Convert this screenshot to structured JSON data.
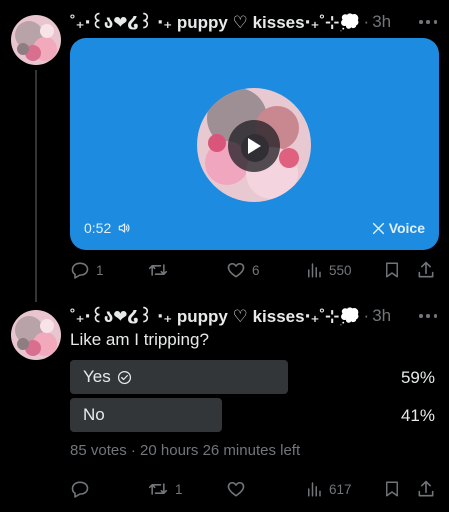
{
  "tweet1": {
    "author": "˚₊‧꒰ა❤︎໒꒱ ‧₊ puppy ♡ kisses‧₊˚⊹💭",
    "time": "3h",
    "voice": {
      "duration": "0:52",
      "label": "Voice"
    },
    "actions": {
      "replies": "1",
      "reposts": "",
      "likes": "6",
      "views": "550"
    }
  },
  "tweet2": {
    "author": "˚₊‧꒰ა❤︎໒꒱ ‧₊ puppy ♡ kisses‧₊˚⊹💭",
    "time": "3h",
    "text": "Like am I tripping?",
    "poll": {
      "options": [
        {
          "label": "Yes",
          "percent": "59%",
          "fraction": 0.59,
          "voted": true
        },
        {
          "label": "No",
          "percent": "41%",
          "fraction": 0.41,
          "voted": false
        }
      ],
      "meta": "85 votes · 20 hours 26 minutes left"
    },
    "actions": {
      "replies": "",
      "reposts": "1",
      "likes": "",
      "views": "617"
    }
  },
  "colors": {
    "background": "#000000",
    "voice_card": "#1d8be0",
    "muted": "#71767b",
    "poll_bar": "#333639"
  },
  "icons": [
    "more-icon",
    "play-icon",
    "volume-icon",
    "x-logo-icon",
    "reply-icon",
    "repost-icon",
    "like-icon",
    "views-icon",
    "bookmark-icon",
    "share-icon",
    "check-circle-icon"
  ]
}
